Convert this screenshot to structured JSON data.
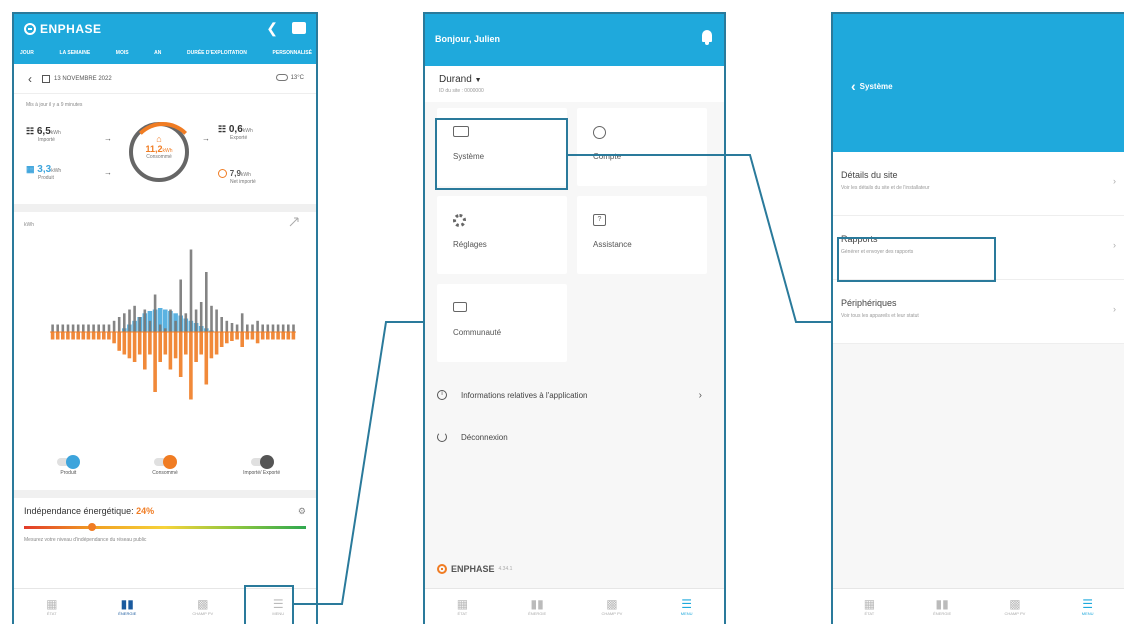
{
  "phone1": {
    "brand": "ENPHASE",
    "tabs": [
      "JOUR",
      "LA SEMAINE",
      "MOIS",
      "AN",
      "DURÉE D'EXPLOITATION",
      "PERSONNALISÉ"
    ],
    "date": "13 NOVEMBRE 2022",
    "weather": "13°C",
    "updated": "Mis à jour il y a 9 minutes",
    "imported": {
      "value": "6,5",
      "unit": "kWh",
      "label": "Importé"
    },
    "produced": {
      "value": "3,3",
      "unit": "kWh",
      "label": "Produit"
    },
    "consumed": {
      "value": "11,2",
      "unit": "kWh",
      "label": "Consommé"
    },
    "exported": {
      "value": "0,6",
      "unit": "kWh",
      "label": "Exporté"
    },
    "net_import": {
      "value": "7,9",
      "unit": "kWh",
      "label": "Net importé"
    },
    "chart_unit": "kWh",
    "legend": [
      "Produit",
      "Consommé",
      "Importé/ Exporté"
    ],
    "independence_label": "Indépendance énergétique:",
    "independence_value": "24%",
    "independence_note": "Mesurez votre niveau d'indépendance du réseau public",
    "nav": [
      "ÉTAT",
      "ÉNERGIE",
      "CHAMP PV",
      "MENU"
    ]
  },
  "phone2": {
    "greeting": "Bonjour, Julien",
    "site_name": "Durand",
    "site_id": "ID du site : 0000000",
    "cards": [
      "Système",
      "Compte",
      "Réglages",
      "Assistance",
      "Communauté"
    ],
    "info_row": "Informations relatives à l'application",
    "logout_row": "Déconnexion",
    "brand": "ENPHASE",
    "version": "4.34.1",
    "nav": [
      "ÉTAT",
      "ÉNERGIE",
      "CHAMP PV",
      "MENU"
    ]
  },
  "phone3": {
    "back": "Système",
    "rows": [
      {
        "title": "Détails du site",
        "desc": "Voir les détails du site et de l'installateur"
      },
      {
        "title": "Rapports",
        "desc": "Générer et envoyer des rapports"
      },
      {
        "title": "Périphériques",
        "desc": "Voir tous les appareils et leur statut"
      }
    ],
    "nav": [
      "ÉTAT",
      "ÉNERGIE",
      "CHAMP PV",
      "MENU"
    ]
  },
  "colors": {
    "brand_blue": "#1fa9dc",
    "consumption_orange": "#f07c23",
    "production_blue": "#3da4dc",
    "grid_gray": "#666666",
    "connector": "#2a7a9b"
  },
  "chart_data": {
    "type": "bar",
    "x": [
      0,
      1,
      2,
      3,
      4,
      5,
      6,
      7,
      8,
      9,
      10,
      11,
      12,
      13,
      14,
      15,
      16,
      17,
      18,
      19,
      20,
      21,
      22,
      23,
      24,
      25,
      26,
      27,
      28,
      29,
      30,
      31,
      32,
      33,
      34,
      35,
      36,
      37,
      38,
      39,
      40,
      41,
      42,
      43,
      44,
      45,
      46,
      47
    ],
    "series": [
      {
        "name": "Produit",
        "values": [
          0,
          0,
          0,
          0,
          0,
          0,
          0,
          0,
          0,
          0,
          0,
          0,
          0,
          0,
          0.05,
          0.1,
          0.15,
          0.2,
          0.25,
          0.28,
          0.3,
          0.32,
          0.3,
          0.28,
          0.25,
          0.22,
          0.18,
          0.15,
          0.12,
          0.08,
          0.05,
          0.02,
          0,
          0,
          0,
          0,
          0,
          0,
          0,
          0,
          0,
          0,
          0,
          0,
          0,
          0,
          0,
          0
        ]
      },
      {
        "name": "Consommé",
        "values": [
          -0.1,
          -0.1,
          -0.1,
          -0.1,
          -0.1,
          -0.1,
          -0.1,
          -0.1,
          -0.1,
          -0.1,
          -0.1,
          -0.1,
          -0.15,
          -0.25,
          -0.3,
          -0.35,
          -0.4,
          -0.3,
          -0.5,
          -0.3,
          -0.8,
          -0.4,
          -0.3,
          -0.5,
          -0.35,
          -0.6,
          -0.3,
          -0.9,
          -0.4,
          -0.3,
          -0.7,
          -0.35,
          -0.3,
          -0.2,
          -0.15,
          -0.12,
          -0.1,
          -0.2,
          -0.1,
          -0.1,
          -0.15,
          -0.1,
          -0.1,
          -0.1,
          -0.1,
          -0.1,
          -0.1,
          -0.1
        ]
      },
      {
        "name": "Importé/ Exporté",
        "values": [
          0.1,
          0.1,
          0.1,
          0.1,
          0.1,
          0.1,
          0.1,
          0.1,
          0.1,
          0.1,
          0.1,
          0.1,
          0.15,
          0.2,
          0.25,
          0.3,
          0.35,
          0.2,
          0.3,
          0.15,
          0.5,
          0.1,
          0.05,
          0.3,
          0.15,
          0.7,
          0.25,
          1.1,
          0.3,
          0.4,
          0.8,
          0.35,
          0.3,
          0.2,
          0.15,
          0.12,
          0.1,
          0.25,
          0.1,
          0.1,
          0.15,
          0.1,
          0.1,
          0.1,
          0.1,
          0.1,
          0.1,
          0.1
        ]
      }
    ],
    "ylabel": "kWh",
    "ylim": [
      -1.2,
      1.2
    ],
    "grid": false,
    "legend": "bottom"
  }
}
